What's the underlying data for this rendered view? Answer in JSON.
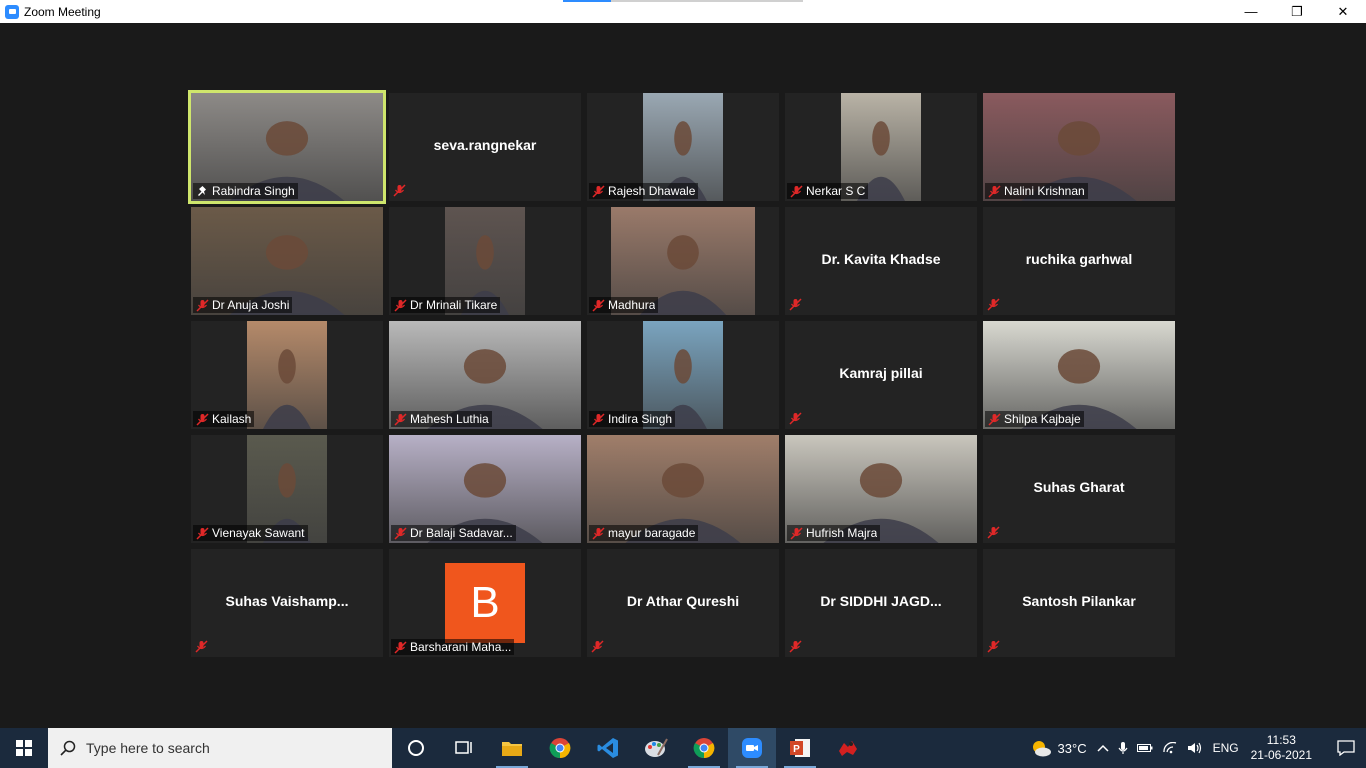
{
  "window": {
    "title": "Zoom Meeting",
    "min_label": "—",
    "max_label": "❐",
    "close_label": "✕"
  },
  "colors": {
    "active_speaker": "#cfe66c",
    "tile_bg": "#232323",
    "stage_bg": "#1a1a1a",
    "avatar": "#f0561d",
    "muted_icon": "#e02828"
  },
  "participants": [
    {
      "name": "Rabindra Singh",
      "video": true,
      "active": true,
      "pinned": true
    },
    {
      "name": "seva.rangnekar",
      "video": false
    },
    {
      "name": "Rajesh Dhawale",
      "video": true
    },
    {
      "name": "Nerkar S C",
      "video": true
    },
    {
      "name": "Nalini Krishnan",
      "video": true
    },
    {
      "name": "Dr Anuja Joshi",
      "video": true
    },
    {
      "name": "Dr Mrinali Tikare",
      "video": true
    },
    {
      "name": "Madhura",
      "video": true
    },
    {
      "name": "Dr. Kavita Khadse",
      "video": false
    },
    {
      "name": "ruchika garhwal",
      "video": false
    },
    {
      "name": "Kailash",
      "video": true
    },
    {
      "name": "Mahesh Luthia",
      "video": true
    },
    {
      "name": "Indira Singh",
      "video": true
    },
    {
      "name": "Kamraj pillai",
      "video": false
    },
    {
      "name": "Shilpa Kajbaje",
      "video": true
    },
    {
      "name": "Vienayak Sawant",
      "video": true
    },
    {
      "name": "Dr Balaji Sadavar...",
      "video": true
    },
    {
      "name": "mayur baragade",
      "video": true
    },
    {
      "name": "Hufrish Majra",
      "video": true
    },
    {
      "name": "Suhas Gharat",
      "video": false
    },
    {
      "name": "Suhas  Vaishamp...",
      "video": false
    },
    {
      "name": "Barsharani Maha...",
      "video": false,
      "avatar_letter": "B"
    },
    {
      "name": "Dr Athar Qureshi",
      "video": false
    },
    {
      "name": "Dr SIDDHI JAGD...",
      "video": false
    },
    {
      "name": "Santosh Pilankar",
      "video": false
    }
  ],
  "taskbar": {
    "search_placeholder": "Type here to search",
    "apps": [
      "task-view",
      "file-explorer",
      "chrome",
      "vscode",
      "paint",
      "chrome-2",
      "zoom",
      "powerpoint",
      "game"
    ],
    "temperature": "33°C",
    "language": "ENG",
    "time": "11:53",
    "date": "21-06-2021"
  }
}
